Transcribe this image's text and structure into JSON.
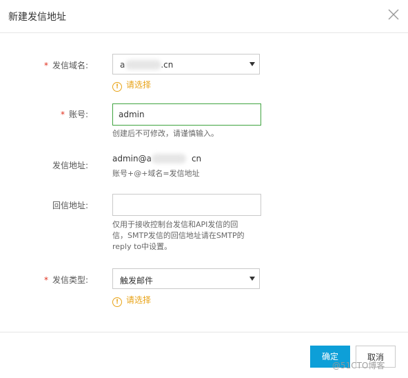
{
  "dialog": {
    "title": "新建发信地址"
  },
  "form": {
    "domain": {
      "label": "发信域名:",
      "prefix": "a",
      "suffix": ".cn",
      "warning": "请选择"
    },
    "account": {
      "label": "账号:",
      "value": "admin",
      "hint": "创建后不可修改，请谨慎输入。"
    },
    "address": {
      "label": "发信地址:",
      "prefix": "admin@a",
      "suffix": "cn",
      "hint": "账号+@+域名=发信地址"
    },
    "reply": {
      "label": "回信地址:",
      "value": "",
      "hint_line1": "仅用于接收控制台发信和API发信的回",
      "hint_line2": "信，SMTP发信的回信地址请在SMTP的",
      "hint_line3": "reply to中设置。"
    },
    "type": {
      "label": "发信类型:",
      "value": "触发邮件",
      "warning": "请选择"
    },
    "required_mark": "*",
    "warning_icon": "!"
  },
  "footer": {
    "confirm": "确定",
    "cancel": "取消"
  },
  "watermark": "@51CTO博客"
}
